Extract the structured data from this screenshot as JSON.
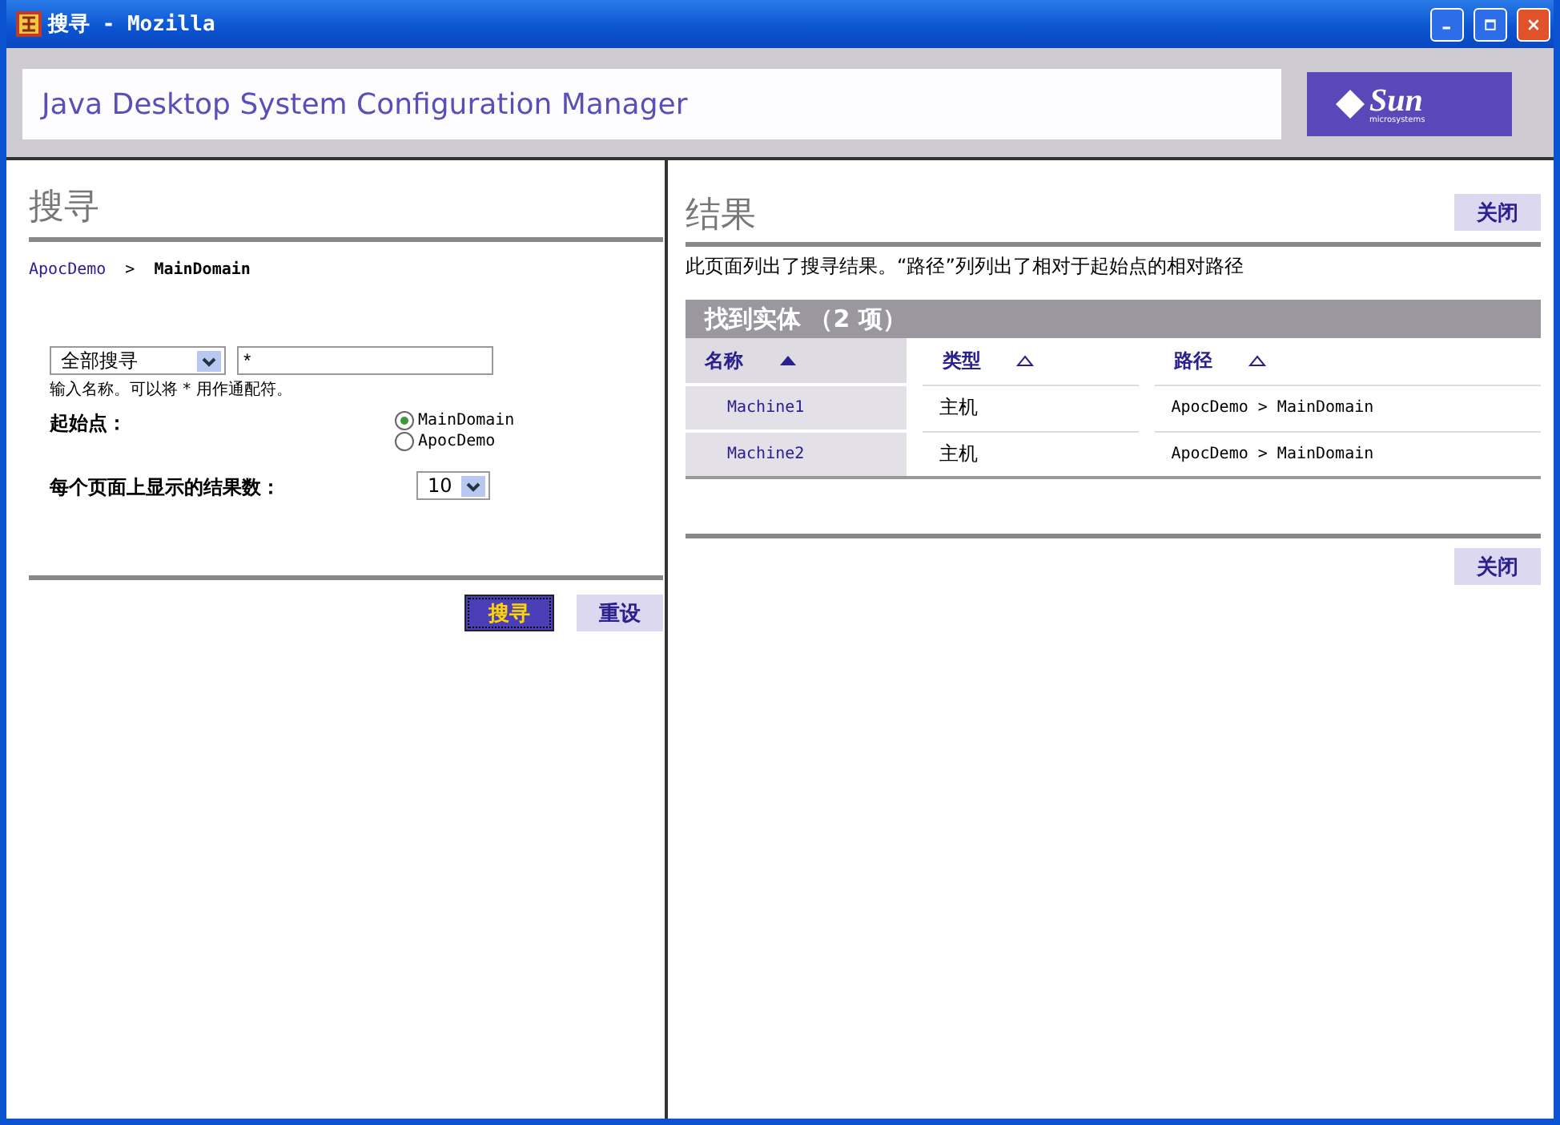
{
  "window": {
    "title": "搜寻 - Mozilla"
  },
  "header": {
    "title": "Java Desktop System Configuration Manager",
    "logo": {
      "text": "Sun",
      "subtext": "microsystems"
    }
  },
  "search": {
    "heading": "搜寻",
    "breadcrumb": [
      {
        "label": "ApocDemo",
        "current": false
      },
      {
        "label": "MainDomain",
        "current": true
      }
    ],
    "breadcrumb_separator": ">",
    "scope_select": {
      "value": "全部搜寻"
    },
    "query_field": {
      "value": "*"
    },
    "hint": "输入名称。可以将 * 用作通配符。",
    "start_label": "起始点：",
    "start_options": [
      {
        "label": "MainDomain",
        "selected": true
      },
      {
        "label": "ApocDemo",
        "selected": false
      }
    ],
    "per_page_label": "每个页面上显示的结果数：",
    "per_page_select": {
      "value": "10"
    },
    "buttons": [
      {
        "label": "搜寻",
        "kind": "primary"
      },
      {
        "label": "重设",
        "kind": "secondary"
      }
    ]
  },
  "results": {
    "heading": "结果",
    "top_button": "关闭",
    "description": "此页面列出了搜寻结果。“路径”列列出了相对于起始点的相对路径",
    "table": {
      "title": "找到实体 （2 项）",
      "columns": [
        {
          "label": "名称",
          "sorted": true
        },
        {
          "label": "类型",
          "sorted": false
        },
        {
          "label": "路径",
          "sorted": false
        }
      ],
      "rows": [
        {
          "name": "Machine1",
          "type": "主机",
          "path": "ApocDemo > MainDomain"
        },
        {
          "name": "Machine2",
          "type": "主机",
          "path": "ApocDemo > MainDomain"
        }
      ]
    },
    "bottom_button": "关闭"
  }
}
